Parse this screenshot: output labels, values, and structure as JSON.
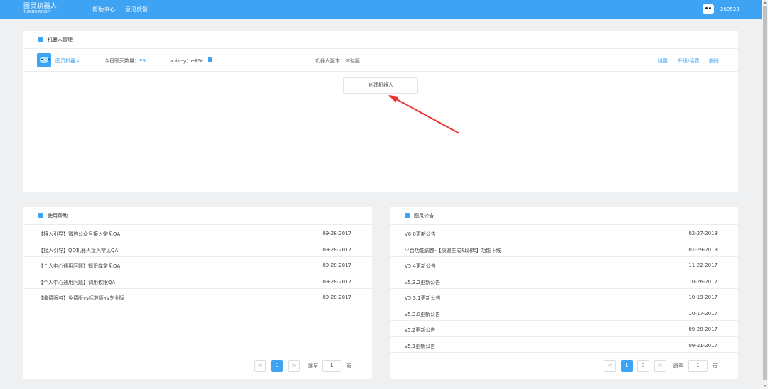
{
  "header": {
    "logo_line1": "图灵机器人",
    "logo_line2": "TURING ROBOT",
    "nav": [
      "帮助中心",
      "意见反馈"
    ],
    "user_id": "260523"
  },
  "robot_panel": {
    "title": "机器人管理",
    "robot": {
      "name": "图灵机器人",
      "chat_count_label": "今日聊天数量：",
      "chat_count": "99",
      "apikey": "apikey：e66e...",
      "version": "机器人版本：体验版",
      "actions": [
        "设置",
        "升级/续费",
        "删除"
      ]
    },
    "create_button": "创建机器人"
  },
  "help_panel": {
    "title": "使用帮助",
    "items": [
      {
        "title": "【接入引导】微信公众号接入常见QA",
        "date": "09-28-2017"
      },
      {
        "title": "【接入引导】QQ机器人接入常见QA",
        "date": "09-28-2017"
      },
      {
        "title": "【个人中心通用问题】知识库常见QA",
        "date": "09-28-2017"
      },
      {
        "title": "【个人中心通用问题】调用权限QA",
        "date": "09-28-2017"
      },
      {
        "title": "【收费服务】免费版vs标准版vs专业版",
        "date": "09-28-2017"
      }
    ],
    "pager": {
      "prev": "<",
      "pages": [
        "1"
      ],
      "next": ">",
      "goto_label": "跳至",
      "goto_value": "1",
      "page_label": "页"
    }
  },
  "notice_panel": {
    "title": "图灵公告",
    "items": [
      {
        "title": "V6.0更新公告",
        "date": "02-27-2018"
      },
      {
        "title": "平台功能调整-【快速生成知识库】功能下线",
        "date": "01-29-2018"
      },
      {
        "title": "V5.4更新公告",
        "date": "11-22-2017"
      },
      {
        "title": "v5.3.2更新公告",
        "date": "10-26-2017"
      },
      {
        "title": "V5.3.1更新公告",
        "date": "10-19-2017"
      },
      {
        "title": "v5.3.0更新公告",
        "date": "10-17-2017"
      },
      {
        "title": "v5.2更新公告",
        "date": "09-28-2017"
      },
      {
        "title": "v5.1更新公告",
        "date": "09-21-2017"
      }
    ],
    "pager": {
      "prev": "<",
      "pages": [
        "1",
        "2"
      ],
      "next": ">",
      "goto_label": "跳至",
      "goto_value": "1",
      "page_label": "页"
    }
  },
  "colors": {
    "accent": "#3ea3f3",
    "annotation_arrow": "#e8332f",
    "background": "#eff0f2"
  }
}
